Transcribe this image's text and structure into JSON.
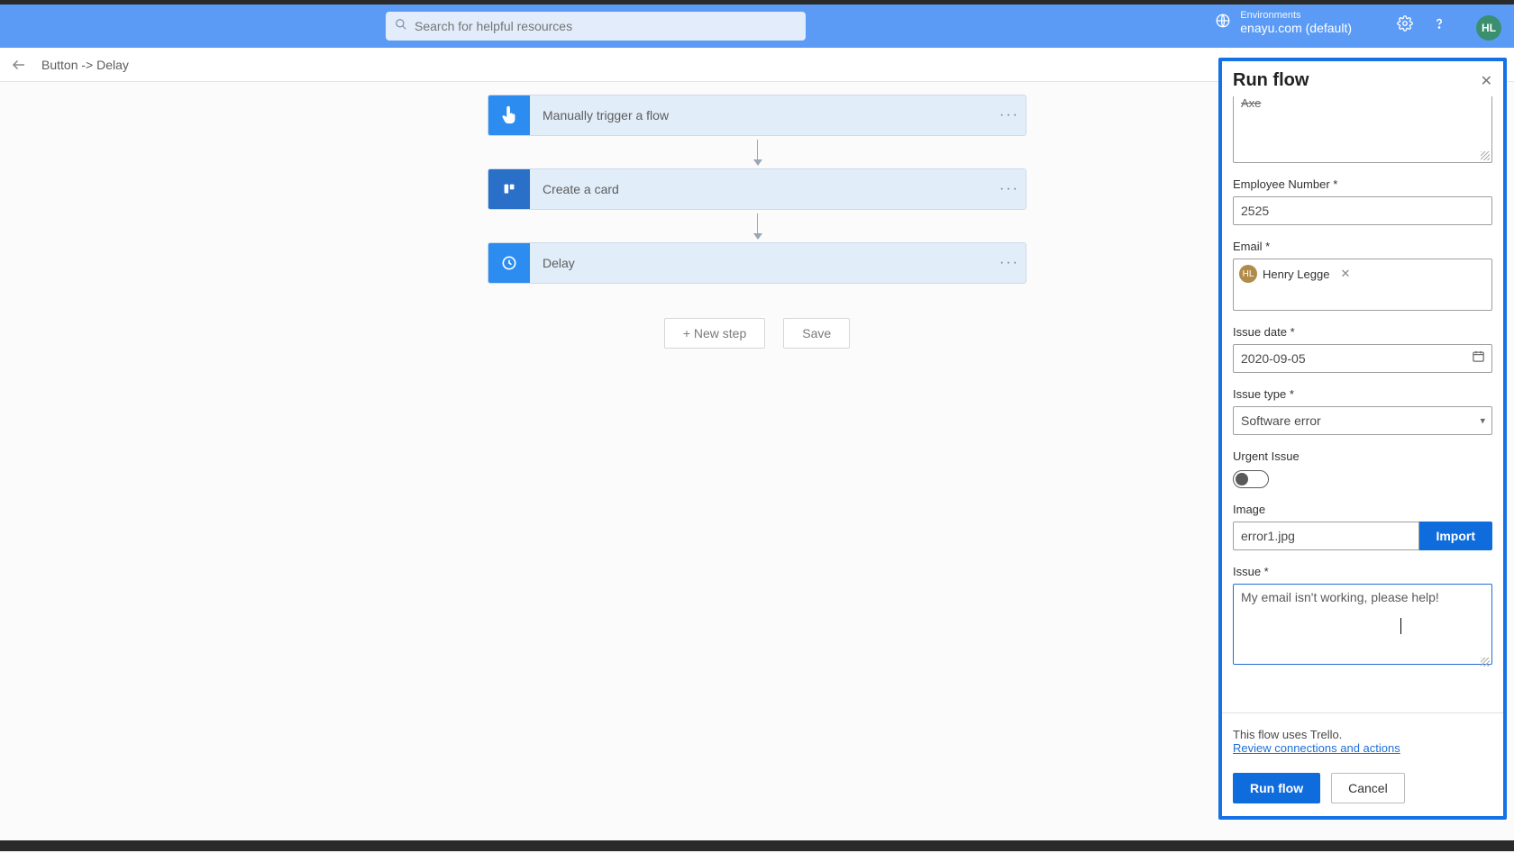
{
  "header": {
    "search_placeholder": "Search for helpful resources",
    "env_label": "Environments",
    "env_value": "enayu.com (default)",
    "avatar_initials": "HL"
  },
  "breadcrumb": "Button -> Delay",
  "flow": {
    "steps": [
      {
        "label": "Manually trigger a flow"
      },
      {
        "label": "Create a card"
      },
      {
        "label": "Delay"
      }
    ],
    "new_step_label": "+ New step",
    "save_label": "Save"
  },
  "panel": {
    "title": "Run flow",
    "top_textarea_value": "Axe",
    "fields": {
      "employee_number": {
        "label": "Employee Number *",
        "value": "2525"
      },
      "email": {
        "label": "Email *",
        "chip_name": "Henry Legge",
        "chip_initials": "HL"
      },
      "issue_date": {
        "label": "Issue date *",
        "value": "2020-09-05"
      },
      "issue_type": {
        "label": "Issue type *",
        "value": "Software error"
      },
      "urgent": {
        "label": "Urgent Issue",
        "value": false
      },
      "image": {
        "label": "Image",
        "value": "error1.jpg",
        "import_label": "Import"
      },
      "issue": {
        "label": "Issue *",
        "value": "My email isn't working, please help!"
      }
    },
    "footer_note": "This flow uses Trello.",
    "footer_link": "Review connections and actions",
    "run_label": "Run flow",
    "cancel_label": "Cancel"
  }
}
